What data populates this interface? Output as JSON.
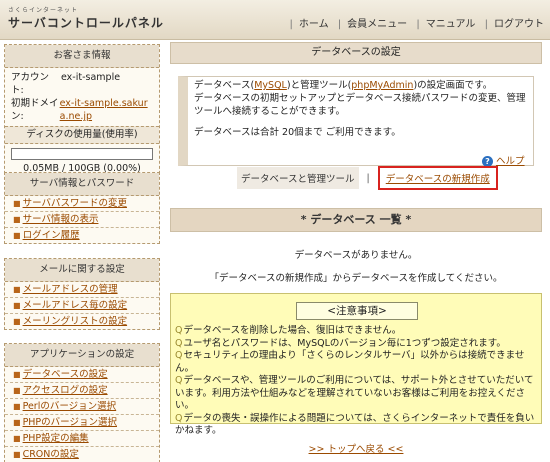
{
  "header": {
    "logo_small": "さくらインターネット",
    "logo_main": "サーバコントロールパネル",
    "nav": [
      "ホーム",
      "会員メニュー",
      "マニュアル",
      "ログアウト"
    ]
  },
  "account_box": {
    "title": "お客さま情報",
    "account_label": "アカウント:",
    "account_value": "ex-it-sample",
    "domain_label": "初期ドメイン:",
    "domain_value": "ex-it-sample.sakura.ne.jp",
    "disk_title": "ディスクの使用量(使用率)",
    "disk_usage_fraction": 0.0,
    "disk_value": "0.05MB / 100GB (0.00%)"
  },
  "server_box": {
    "title": "サーバ情報とパスワード",
    "items": [
      "サーバパスワードの変更",
      "サーバ情報の表示",
      "ログイン履歴"
    ]
  },
  "mail_box": {
    "title": "メールに関する設定",
    "items": [
      "メールアドレスの管理",
      "メールアドレス毎の設定",
      "メーリングリストの設定"
    ]
  },
  "app_box": {
    "title": "アプリケーションの設定",
    "items": [
      "データベースの設定",
      "アクセスログの設定",
      "Perlのバージョン選択",
      "PHPのバージョン選択",
      "PHP設定の編集",
      "CRONの設定"
    ]
  },
  "main": {
    "title": "データベースの設定",
    "desc_pre": "データベース(",
    "mysql_link": "MySQL",
    "desc_mid": ")と管理ツール(",
    "pma_link": "phpMyAdmin",
    "desc_post": ")の設定画面です。",
    "desc_line2": "データベースの初期セットアップとデータベース接続パスワードの変更、管理ツールへ接続することができます。",
    "desc_line3": "データベースは合計 20個まで ご利用できます。",
    "help_label": "ヘルプ",
    "tab_current": "データベースと管理ツール",
    "tab_new": "データベースの新規作成",
    "list_title": "* データベース 一覧 *",
    "no_db": "データベースがありません。",
    "hint": "「データベースの新規作成」からデータベースを作成してください。",
    "back_link": ">> トップへ戻る <<"
  },
  "notes": {
    "title": "<注意事項>",
    "items": [
      "データベースを削除した場合、復旧はできません。",
      "ユーザ名とパスワードは、MySQLのバージョン毎に1つずつ設定されます。",
      "セキュリティ上の理由より「さくらのレンタルサーバ」以外からは接続できません。",
      "データベースや、管理ツールのご利用については、サポート外とさせていただいています。利用方法や仕組みなどを理解されていないお客様はご利用をお控えください。",
      "データの喪失・誤操作による問題については、さくらインターネットで責任を負いかねます。"
    ]
  }
}
